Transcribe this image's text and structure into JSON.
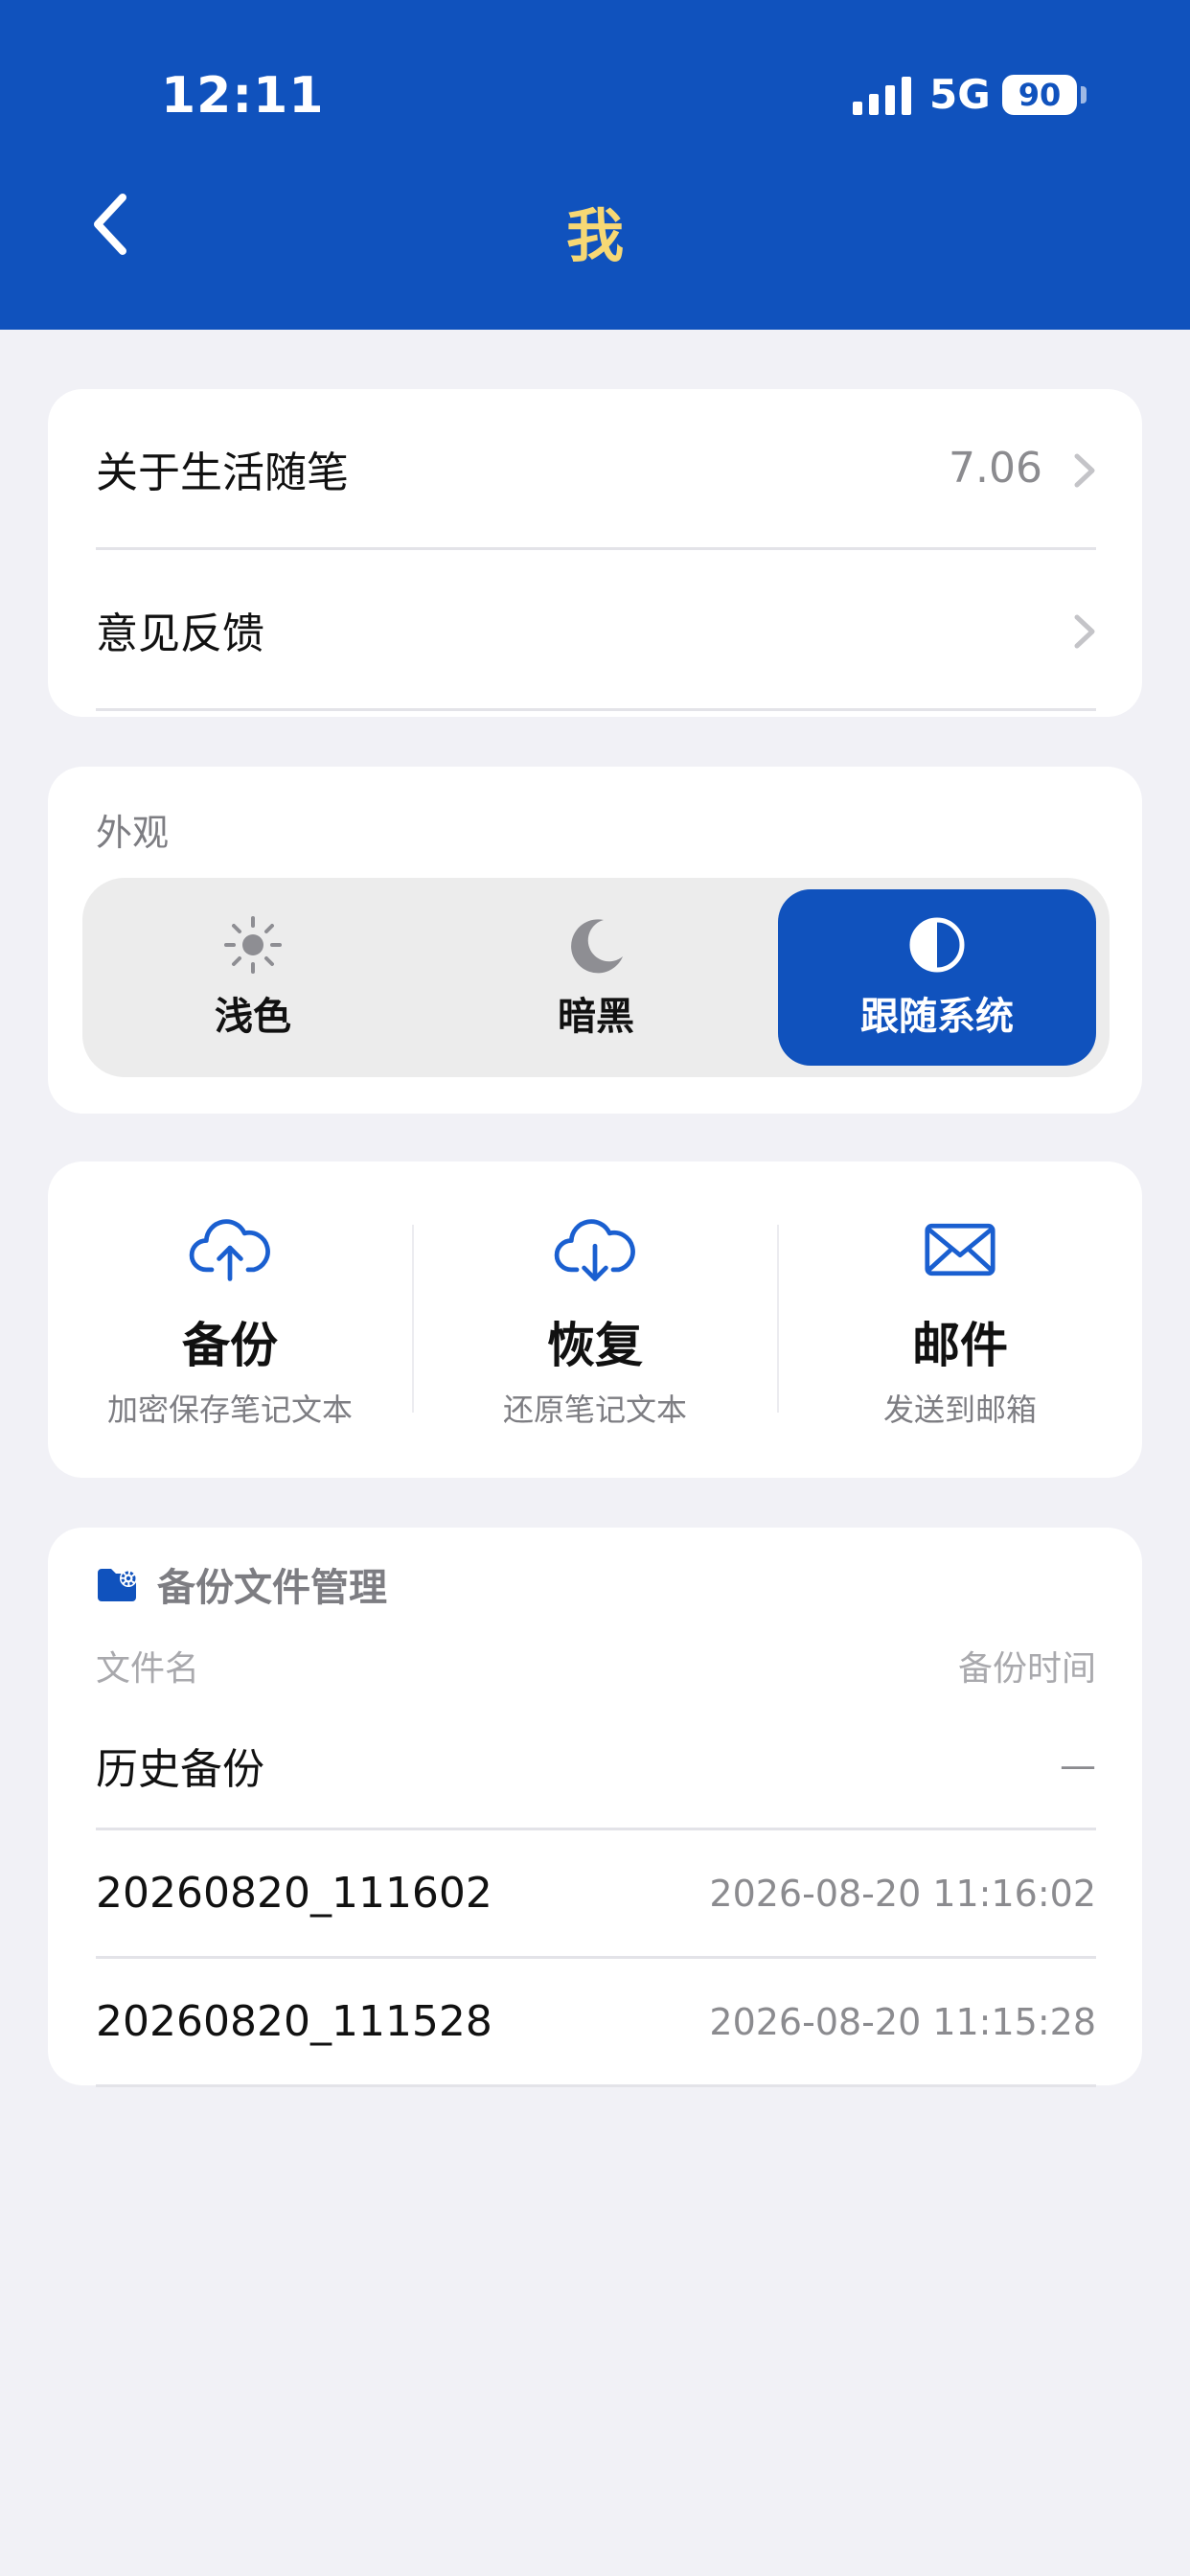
{
  "status_bar": {
    "time": "12:11",
    "network": "5G",
    "battery": "90"
  },
  "header": {
    "title": "我",
    "back_icon": "chevron-left-icon"
  },
  "colors": {
    "primary": "#1052bd",
    "title": "#f7d874",
    "background": "#f1f1f6"
  },
  "menu": {
    "about": {
      "label": "关于生活随笔",
      "value": "7.06"
    },
    "feedback": {
      "label": "意见反馈"
    }
  },
  "appearance": {
    "label": "外观",
    "options": [
      {
        "label": "浅色",
        "icon": "sun-icon"
      },
      {
        "label": "暗黑",
        "icon": "moon-icon"
      },
      {
        "label": "跟随系统",
        "icon": "half-circle-icon"
      }
    ],
    "selected": "跟随系统"
  },
  "actions": [
    {
      "title": "备份",
      "subtitle": "加密保存笔记文本",
      "icon": "cloud-upload-icon"
    },
    {
      "title": "恢复",
      "subtitle": "还原笔记文本",
      "icon": "cloud-download-icon"
    },
    {
      "title": "邮件",
      "subtitle": "发送到邮箱",
      "icon": "mail-icon"
    }
  ],
  "file_manager": {
    "title": "备份文件管理",
    "icon": "folder-gear-icon",
    "columns": {
      "name": "文件名",
      "time": "备份时间"
    },
    "rows": [
      {
        "name": "历史备份",
        "time": "—"
      },
      {
        "name": "20260820_111602",
        "time": "2026-08-20 11:16:02"
      },
      {
        "name": "20260820_111528",
        "time": "2026-08-20 11:15:28"
      }
    ]
  }
}
